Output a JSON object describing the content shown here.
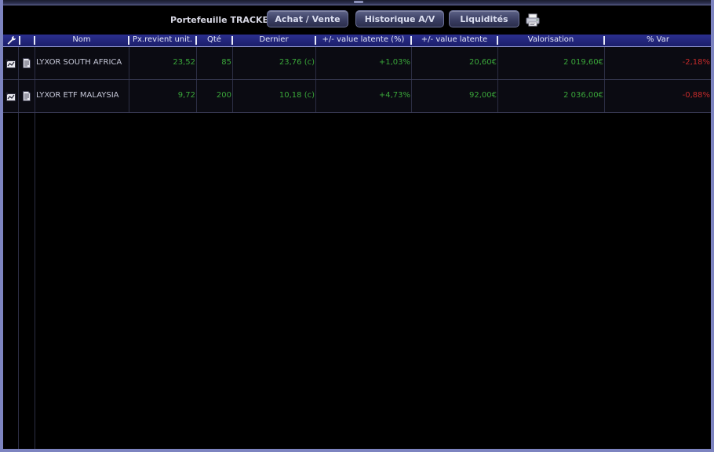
{
  "toolbar": {
    "portfolio_title": "Portefeuille TRACKER",
    "buttons": [
      {
        "label": "Achat / Vente"
      },
      {
        "label": "Historique A/V"
      },
      {
        "label": "Liquidités"
      }
    ],
    "print_icon": "printer-icon"
  },
  "table": {
    "settings_icon": "wrench-icon",
    "columns": [
      "Nom",
      "Px.revient unit.",
      "Qté",
      "Dernier",
      "+/- value latente (%)",
      "+/- value latente",
      "Valorisation",
      "% Var"
    ],
    "rows": [
      {
        "chart_icon": "chart-add-icon",
        "doc_icon": "document-icon",
        "name": "LYXOR SOUTH AFRICA",
        "cost": "23,52",
        "qty": "85",
        "last": "23,76 (c)",
        "latent_pct": "+1,03%",
        "latent": "20,60€",
        "valuation": "2 019,60€",
        "var": "-2,18%"
      },
      {
        "chart_icon": "chart-add-icon",
        "doc_icon": "document-icon",
        "name": "LYXOR ETF MALAYSIA",
        "cost": "9,72",
        "qty": "200",
        "last": "10,18 (c)",
        "latent_pct": "+4,73%",
        "latent": "92,00€",
        "valuation": "2 036,00€",
        "var": "-0,88%"
      }
    ]
  },
  "colors": {
    "positive": "#3aa63a",
    "negative": "#c42a2a",
    "header_bg": "#2b2f8e",
    "frame": "#7d84c0"
  }
}
